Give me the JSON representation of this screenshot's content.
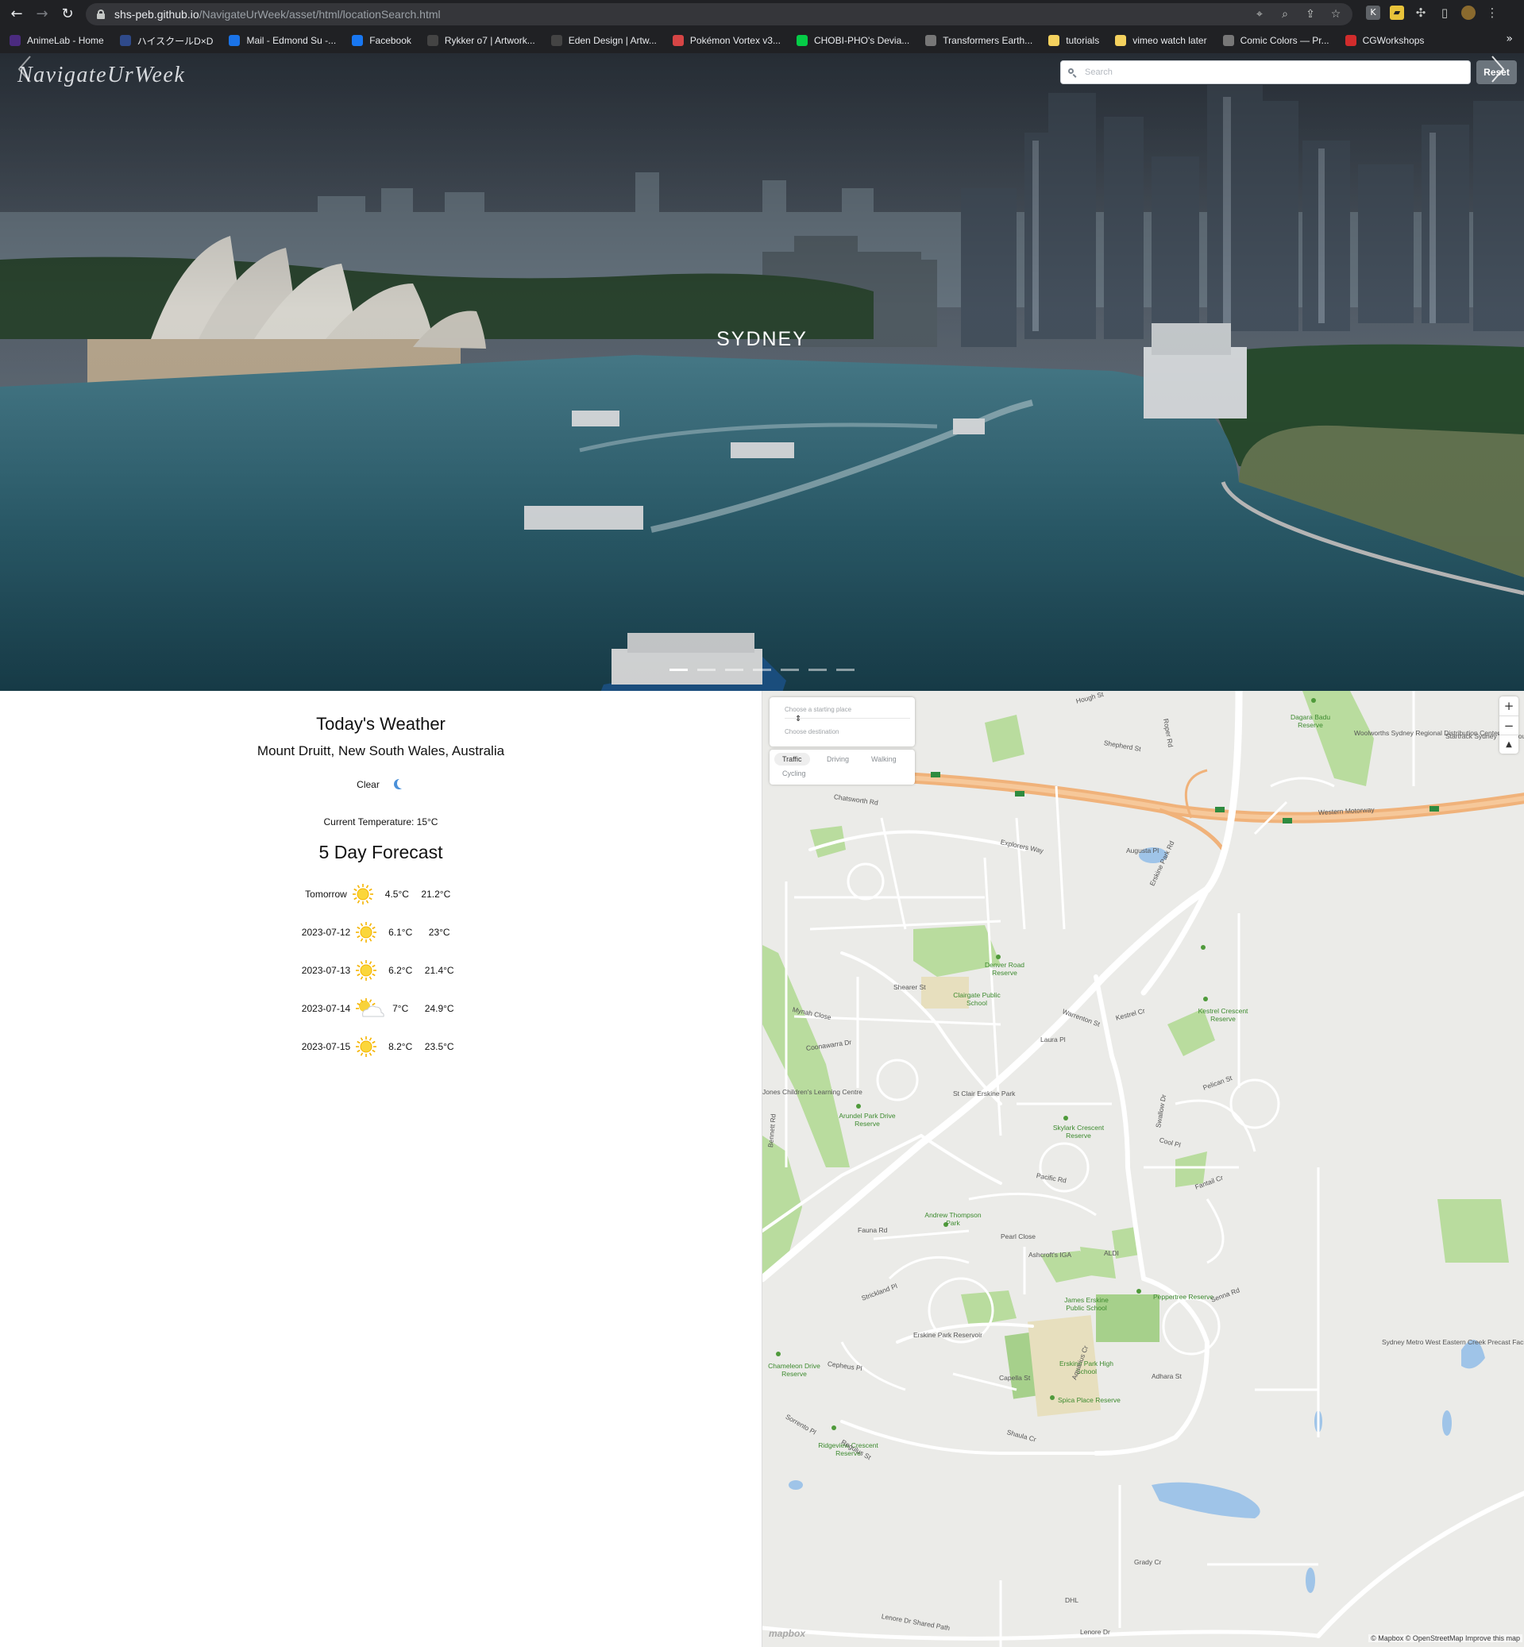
{
  "browser": {
    "url_host": "shs-peb.github.io",
    "url_path": "/NavigateUrWeek/asset/html/locationSearch.html",
    "bookmarks": [
      {
        "label": "AnimeLab - Home",
        "color": "#4b2b7f"
      },
      {
        "label": "ハイスクールD×D",
        "color": "#2f4a8a"
      },
      {
        "label": "Mail - Edmond Su -...",
        "color": "#1a73e8"
      },
      {
        "label": "Facebook",
        "color": "#1877f2"
      },
      {
        "label": "Rykker o7 | Artwork...",
        "color": "#444"
      },
      {
        "label": "Eden Design | Artw...",
        "color": "#444"
      },
      {
        "label": "Pokémon Vortex v3...",
        "color": "#d64545"
      },
      {
        "label": "CHOBI-PHO's Devia...",
        "color": "#05cc47"
      },
      {
        "label": "Transformers Earth...",
        "color": "#777"
      },
      {
        "label": "tutorials",
        "color": "#f4d15e"
      },
      {
        "label": "vimeo watch later",
        "color": "#f4d15e"
      },
      {
        "label": "Comic Colors — Pr...",
        "color": "#777"
      },
      {
        "label": "CGWorkshops",
        "color": "#d12c2c"
      }
    ]
  },
  "header": {
    "brand": "NavigateUrWeek",
    "search_placeholder": "Search",
    "reset_label": "Reset"
  },
  "carousel": {
    "city": "SYDNEY",
    "slide_count": 7,
    "active_index": 0
  },
  "weather": {
    "title": "Today's Weather",
    "location": "Mount Druitt, New South Wales, Australia",
    "condition": "Clear",
    "condition_icon": "moon-icon",
    "current_temp": "Current Temperature: 15°C",
    "forecast_title": "5 Day Forecast",
    "forecast": [
      {
        "day": "Tomorrow",
        "icon": "sun-icon",
        "min": "4.5°C",
        "max": "21.2°C"
      },
      {
        "day": "2023-07-12",
        "icon": "sun-icon",
        "min": "6.1°C",
        "max": "23°C"
      },
      {
        "day": "2023-07-13",
        "icon": "sun-icon",
        "min": "6.2°C",
        "max": "21.4°C"
      },
      {
        "day": "2023-07-14",
        "icon": "partly-cloudy-icon",
        "min": "7°C",
        "max": "24.9°C"
      },
      {
        "day": "2023-07-15",
        "icon": "sun-icon",
        "min": "8.2°C",
        "max": "23.5°C"
      }
    ]
  },
  "map": {
    "origin_placeholder": "Choose a starting place",
    "destination_placeholder": "Choose destination",
    "profiles": [
      "Traffic",
      "Driving",
      "Walking",
      "Cycling"
    ],
    "active_profile": "Traffic",
    "logo": "mapbox",
    "attribution": "© Mapbox © OpenStreetMap  Improve this map",
    "labels": [
      "Western Motorway",
      "Dagara Badu Reserve",
      "Woolworths Sydney Regional Distribution Centers",
      "Startrack Sydney Warehouse",
      "Hough St",
      "Shepherd St",
      "Roper Rd",
      "Chatsworth Rd",
      "Explorers Way",
      "Augusta Pl",
      "Erskine Park Rd",
      "Denver Road Reserve",
      "Clairgate Public School",
      "Shearer St",
      "Mynah Close",
      "Coonawarra Dr",
      "Kestrel Crescent Reserve",
      "St Clair Erskine Park",
      "Arundel Park Drive Reserve",
      "Skylark Crescent Reserve",
      "Swallow Dr",
      "Andrew Thompson Park",
      "Ashcroft's IGA",
      "ALDI",
      "James Erskine Public School",
      "Peppertree Reserve",
      "Erskine Park Reservoir",
      "Erskine Park High School",
      "Spica Place Reserve",
      "Ridgeview Crescent Reserve",
      "Chameleon Drive Reserve",
      "Sydney Metro West Eastern Creek Precast Facility",
      "Lenore Dr",
      "Lenore Dr Shared Path",
      "Grady Cr",
      "DHL",
      "Fauna Rd",
      "Pacific Rd",
      "Cool Pl",
      "Fantail Cr",
      "Pelican St",
      "Kestrel Cr",
      "Laura Pl",
      "Warrenton St",
      "Aquarius Cr",
      "Adhara St",
      "Capella St",
      "Regulus St",
      "Sorrento Pl",
      "Cepheus Pl",
      "Shaula Cr",
      "Pearl Close",
      "Senna Rd",
      "Strickland Pl",
      "Bennett Rd",
      "Jones Children's Learning Centre"
    ]
  }
}
